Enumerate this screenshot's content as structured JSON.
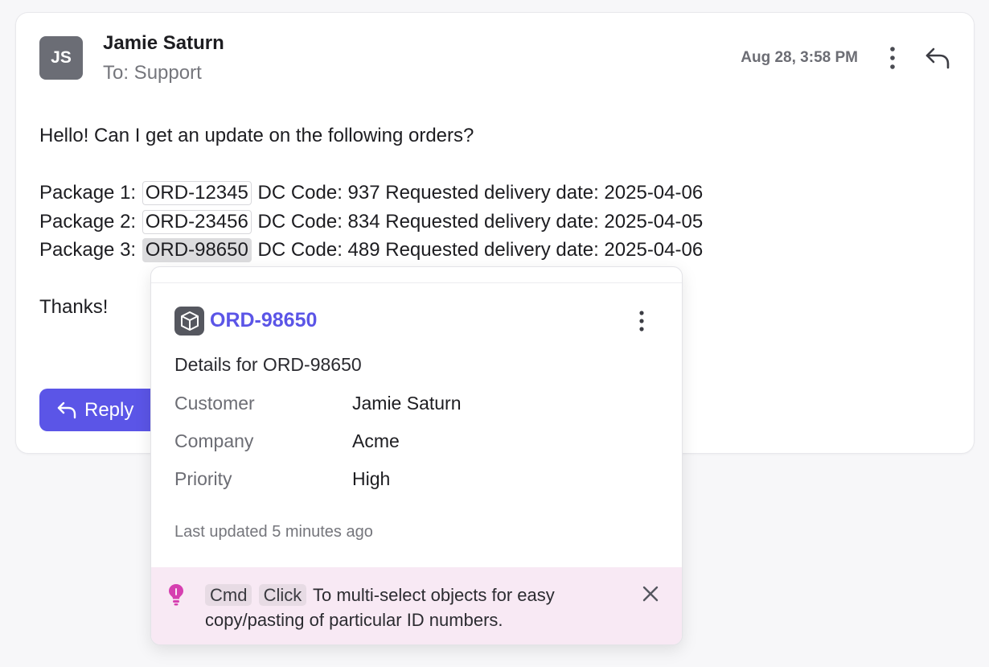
{
  "email": {
    "avatar_initials": "JS",
    "sender": "Jamie Saturn",
    "recipient": "To: Support",
    "timestamp": "Aug 28, 3:58 PM",
    "greeting": "Hello! Can I get an update on the following orders?",
    "packages": [
      {
        "label": "Package 1:",
        "order_id": "ORD-12345",
        "rest": "DC Code: 937 Requested delivery date: 2025-04-06"
      },
      {
        "label": "Package 2:",
        "order_id": "ORD-23456",
        "rest": "DC Code: 834 Requested delivery date: 2025-04-05"
      },
      {
        "label": "Package 3:",
        "order_id": "ORD-98650",
        "rest": "DC Code: 489 Requested delivery date: 2025-04-06"
      }
    ],
    "signoff": "Thanks!",
    "reply_label": "Reply"
  },
  "popover": {
    "title": "ORD-98650",
    "subtitle": "Details for ORD-98650",
    "details": [
      {
        "key": "Customer",
        "value": "Jamie Saturn"
      },
      {
        "key": "Company",
        "value": "Acme"
      },
      {
        "key": "Priority",
        "value": "High"
      }
    ],
    "last_updated": "Last updated 5 minutes ago",
    "tip": {
      "key1": "Cmd",
      "key2": "Click",
      "text": "To multi-select objects for easy copy/pasting of particular ID numbers."
    }
  },
  "colors": {
    "accent": "#5b55e7",
    "tip_background": "#f8e9f4",
    "tip_icon": "#d63fb0",
    "avatar": "#6b6d75"
  },
  "icons": {
    "header_more": "more-vertical-icon",
    "header_reply": "reply-arrow-icon",
    "order_object": "box-icon",
    "tip": "lightbulb-icon",
    "close": "close-icon"
  }
}
